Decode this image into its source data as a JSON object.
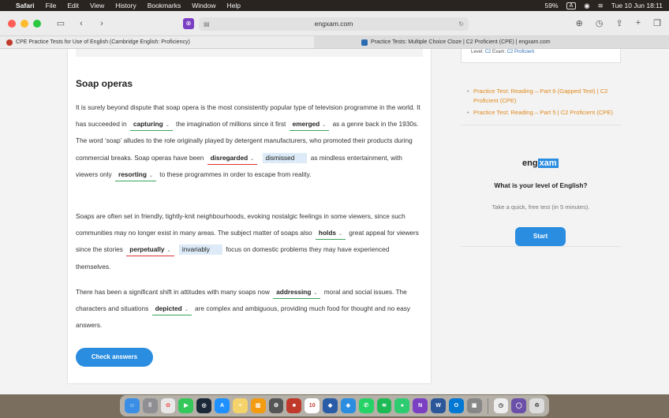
{
  "menubar": {
    "app_name": "Safari",
    "items": [
      "File",
      "Edit",
      "View",
      "History",
      "Bookmarks",
      "Window",
      "Help"
    ],
    "battery": "59%",
    "input_indicator": "A",
    "datetime": "Tue 10 Jun  18:11"
  },
  "browser": {
    "url": "engxam.com",
    "tabs": [
      {
        "title": "CPE Practice Tests for Use of English (Cambridge English: Proficiency)"
      },
      {
        "title": "Practice Tests: Multiple Choice Cloze | C2 Proficient (CPE) | engxam.com"
      }
    ]
  },
  "article": {
    "title": "Soap operas",
    "p1": {
      "t1": "It is surely beyond dispute that soap opera is the most consistently popular type of television programme in the world. It has succeeded in",
      "g1": "capturing",
      "t2": "the imagination of millions since it first",
      "g2": "emerged",
      "t3": "as a genre back in the 1930s. The word ‘soap’ alludes to the role originally played by detergent manufacturers, who promoted their products during commercial breaks. Soap operas have been",
      "g3": "disregarded",
      "c3": "dismissed",
      "t4": "as mindless entertainment, with viewers only",
      "g4": "resorting",
      "t5": "to these programmes in order to escape from reality."
    },
    "p2": {
      "t1": "Soaps are often set in friendly, tightly-knit neighbourhoods, evoking nostalgic feelings in some viewers, since such communities may no longer exist in many areas. The subject matter of soaps also",
      "g1": "holds",
      "t2": "great appeal for viewers since the stories",
      "g2": "perpetually",
      "c2": "invariably",
      "t3": "focus on domestic problems they may have experienced themselves."
    },
    "p3": {
      "t1": "There has been a significant shift in attitudes with many soaps now",
      "g1": "addressing",
      "t2": "moral and social issues. The characters and situations",
      "g2": "depicted",
      "t3": "are complex and ambiguous, providing much food for thought and no easy answers."
    },
    "check_button": "Check answers"
  },
  "sidebar": {
    "level_label": "Level:",
    "level_value": "C2",
    "exam_label": "Exam:",
    "exam_value": "C2 Proficient",
    "related": [
      "Practice Test: Reading – Part 6 (Gapped Text) | C2 Proficient (CPE)",
      "Practice Test: Reading – Part 5 | C2 Proficient (CPE)"
    ],
    "logo_eng": "eng",
    "logo_xam": "xam",
    "question": "What is your level of English?",
    "subtitle": "Take a quick, free test (in 5 minutes).",
    "start_button": "Start"
  },
  "dock": {
    "calendar_day": "10"
  }
}
